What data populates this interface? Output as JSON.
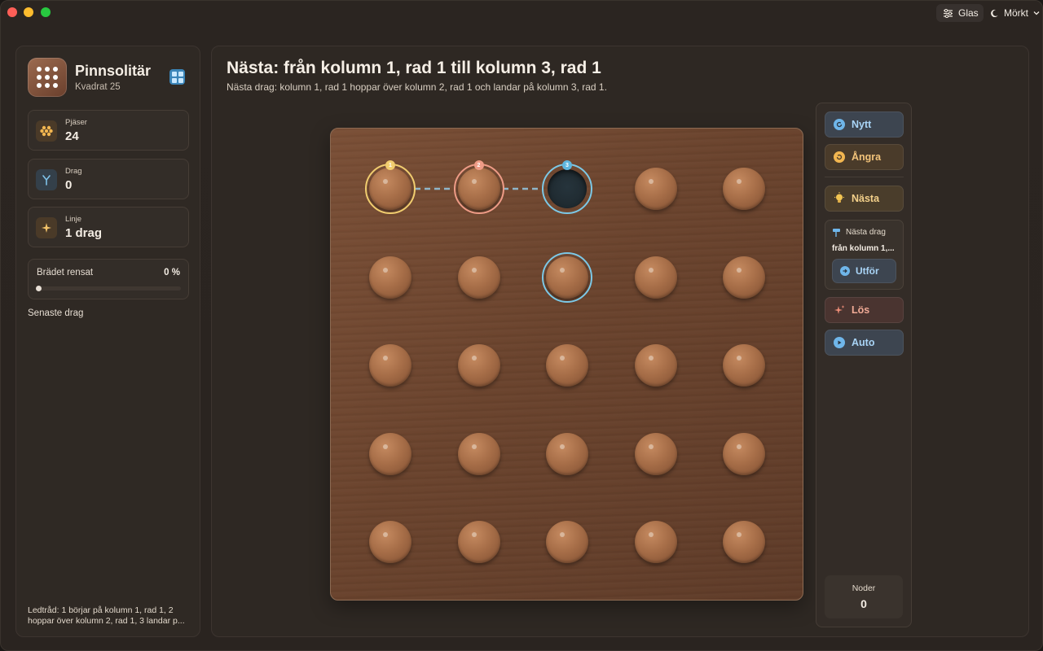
{
  "titlebar": {
    "theme_glass_label": "Glas",
    "theme_mode_label": "Mörkt"
  },
  "sidebar": {
    "app_title": "Pinnsolitär",
    "app_subtitle": "Kvadrat 25",
    "stats": [
      {
        "label": "Pjäser",
        "value": "24",
        "icon": "pegs-icon",
        "color": "#f2b650"
      },
      {
        "label": "Drag",
        "value": "0",
        "icon": "branch-icon",
        "color": "#7fc3ea"
      },
      {
        "label": "Linje",
        "value": "1 drag",
        "icon": "sparkle-icon",
        "color": "#f2c36a"
      }
    ],
    "progress": {
      "label": "Brädet rensat",
      "percent_label": "0 %",
      "value": 0
    },
    "recent_title": "Senaste drag",
    "hint": "Ledtråd: 1 börjar på kolumn 1, rad 1, 2 hoppar över kolumn 2, rad 1, 3 landar p..."
  },
  "main": {
    "title": "Nästa: från kolumn 1, rad 1 till kolumn 3, rad 1",
    "subtitle": "Nästa drag: kolumn 1, rad 1 hoppar över kolumn 2, rad 1 och landar på kolumn 3, rad 1."
  },
  "board": {
    "size": 5,
    "empty": [
      [
        0,
        2
      ]
    ],
    "highlights": [
      {
        "row": 0,
        "col": 0,
        "badge": "1",
        "color": "#f1cd6f"
      },
      {
        "row": 0,
        "col": 1,
        "badge": "2",
        "color": "#ee9b86"
      },
      {
        "row": 0,
        "col": 2,
        "badge": "3",
        "color": "#7cc8e6"
      }
    ],
    "selected": [
      [
        1,
        2
      ]
    ]
  },
  "actions": {
    "new_label": "Nytt",
    "undo_label": "Ångra",
    "next_label": "Nästa",
    "next_card_title": "Nästa drag",
    "next_card_move": "från kolumn 1,...",
    "execute_label": "Utför",
    "solve_label": "Lös",
    "auto_label": "Auto",
    "nodes_label": "Noder",
    "nodes_value": "0"
  },
  "colors": {
    "accent_blue": "#a9d4f6",
    "accent_orange": "#f2c37a",
    "accent_red": "#f0aa96"
  }
}
